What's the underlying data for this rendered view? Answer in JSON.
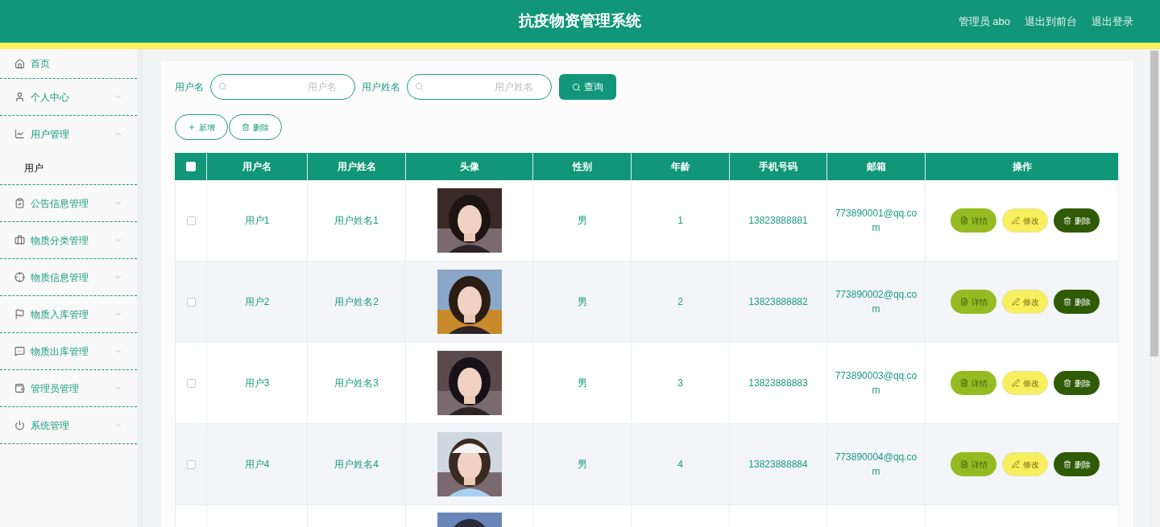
{
  "header": {
    "title": "抗疫物资管理系统",
    "links": [
      "管理员 abo",
      "退出到前台",
      "退出登录"
    ]
  },
  "sidebar": {
    "items": [
      {
        "label": "首页",
        "kind": "link"
      },
      {
        "label": "个人中心",
        "kind": "group",
        "expanded": false
      },
      {
        "label": "用户管理",
        "kind": "group",
        "expanded": true,
        "children": [
          {
            "label": "用户"
          }
        ]
      },
      {
        "label": "公告信息管理",
        "kind": "group",
        "expanded": false
      },
      {
        "label": "物质分类管理",
        "kind": "group",
        "expanded": false
      },
      {
        "label": "物质信息管理",
        "kind": "group",
        "expanded": false
      },
      {
        "label": "物质入库管理",
        "kind": "group",
        "expanded": false
      },
      {
        "label": "物质出库管理",
        "kind": "group",
        "expanded": false
      },
      {
        "label": "管理员管理",
        "kind": "group",
        "expanded": false
      },
      {
        "label": "系统管理",
        "kind": "group",
        "expanded": false
      }
    ]
  },
  "search": {
    "fields": [
      {
        "label": "用户名",
        "placeholder": "用户名"
      },
      {
        "label": "用户姓名",
        "placeholder": "用户姓名"
      }
    ],
    "button": "查询"
  },
  "actions": [
    {
      "kind": "add",
      "label": "新增"
    },
    {
      "kind": "delete",
      "label": "删除"
    }
  ],
  "table": {
    "select_all_checked": false,
    "columns": [
      "用户名",
      "用户姓名",
      "头像",
      "性别",
      "年龄",
      "手机号码",
      "邮箱",
      "操作"
    ],
    "rows": [
      {
        "checked": false,
        "username": "用户1",
        "name": "用户姓名1",
        "avatar": {
          "kind": "picture"
        },
        "gender": "男",
        "age": "1",
        "phone": "13823888881",
        "email": "773890001@qq.co\nm",
        "actions": [
          {
            "kind": "detail",
            "label": "详情"
          },
          {
            "kind": "edit",
            "label": "修改"
          },
          {
            "kind": "delete",
            "label": "删除"
          }
        ]
      },
      {
        "checked": false,
        "username": "用户2",
        "name": "用户姓名2",
        "avatar": {
          "kind": "picture"
        },
        "gender": "男",
        "age": "2",
        "phone": "13823888882",
        "email": "773890002@qq.co\nm",
        "actions": [
          {
            "kind": "detail",
            "label": "详情"
          },
          {
            "kind": "edit",
            "label": "修改"
          },
          {
            "kind": "delete",
            "label": "删除"
          }
        ]
      },
      {
        "checked": false,
        "username": "用户3",
        "name": "用户姓名3",
        "avatar": {
          "kind": "picture"
        },
        "gender": "男",
        "age": "3",
        "phone": "13823888883",
        "email": "773890003@qq.co\nm",
        "actions": [
          {
            "kind": "detail",
            "label": "详情"
          },
          {
            "kind": "edit",
            "label": "修改"
          },
          {
            "kind": "delete",
            "label": "删除"
          }
        ]
      },
      {
        "checked": false,
        "username": "用户4",
        "name": "用户姓名4",
        "avatar": {
          "kind": "picture"
        },
        "gender": "男",
        "age": "4",
        "phone": "13823888884",
        "email": "773890004@qq.co\nm",
        "actions": [
          {
            "kind": "detail",
            "label": "详情"
          },
          {
            "kind": "edit",
            "label": "修改"
          },
          {
            "kind": "delete",
            "label": "删除"
          }
        ]
      },
      {
        "avatar": {
          "kind": "picture"
        }
      }
    ]
  }
}
